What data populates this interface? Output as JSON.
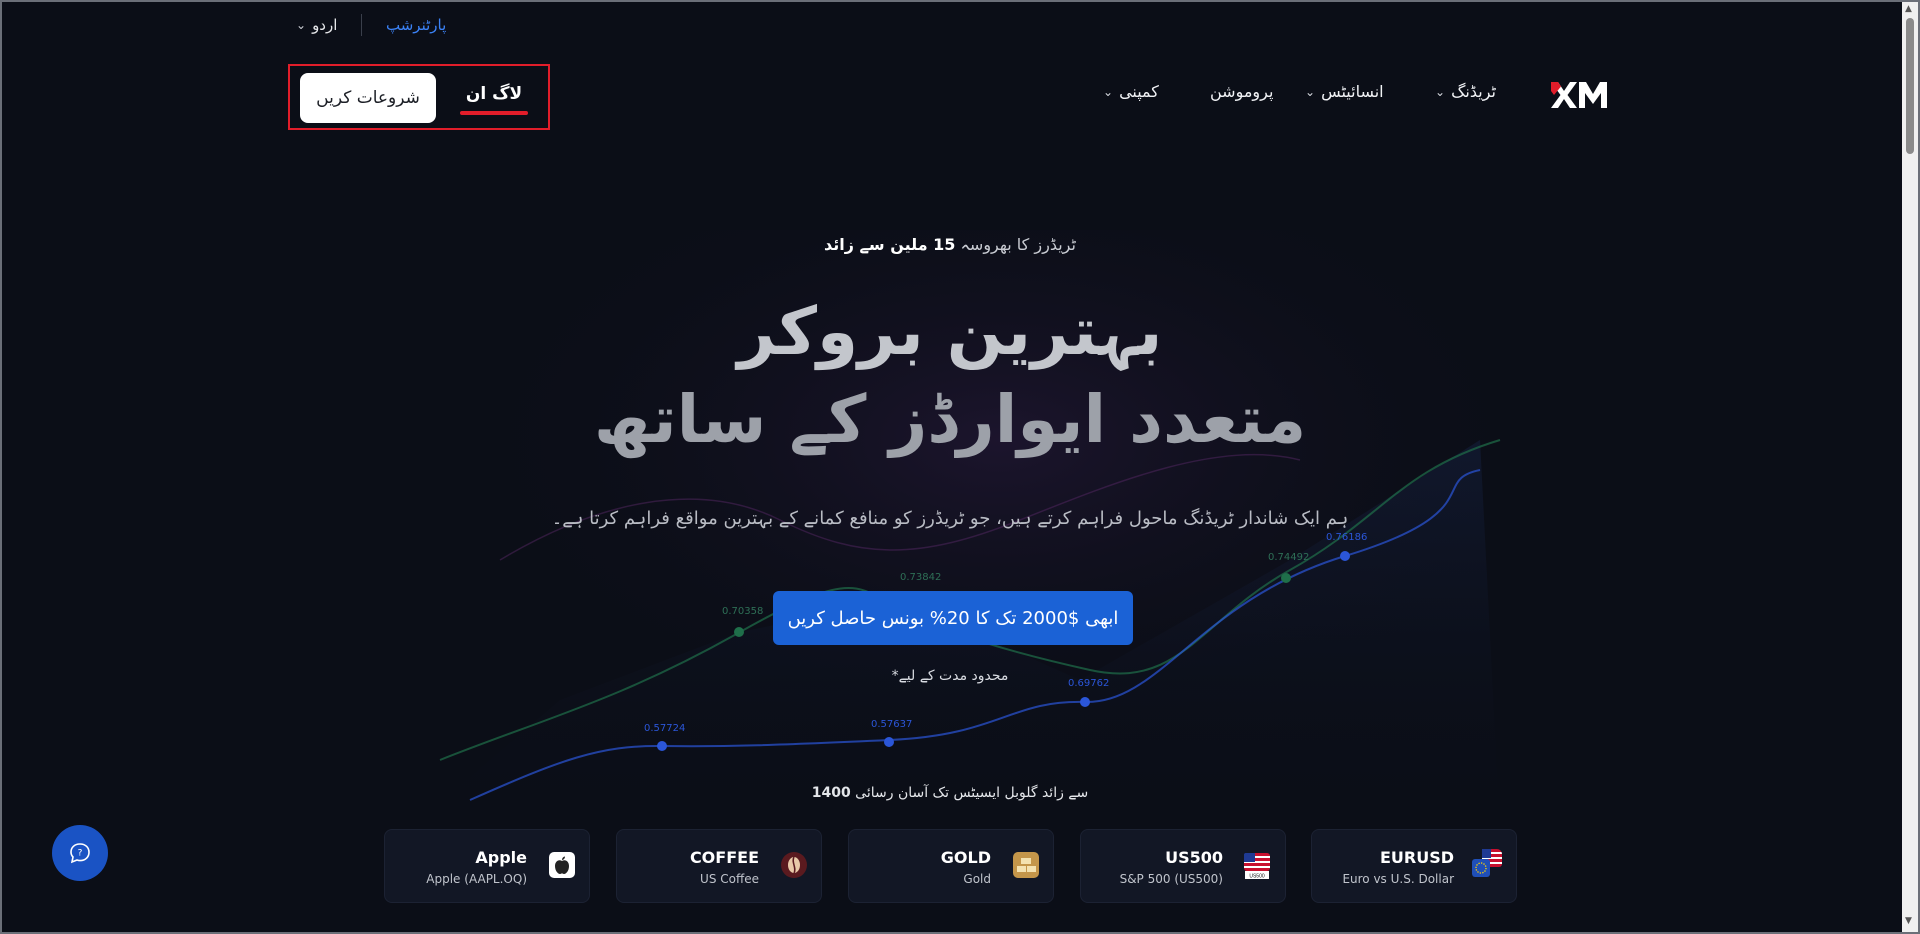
{
  "topbar": {
    "language": "اردو",
    "partnership": "پارٹنرشپ"
  },
  "nav": {
    "items": [
      {
        "label": "ٹریڈنگ",
        "has_dropdown": true
      },
      {
        "label": "انسائیٹس",
        "has_dropdown": true
      },
      {
        "label": "پروموشن",
        "has_dropdown": false
      },
      {
        "label": "کمپنی",
        "has_dropdown": true
      }
    ],
    "login_label": "لاگ ان",
    "start_label": "شروعات کریں",
    "accent_color": "#e11d2a"
  },
  "hero": {
    "trust_bold": "15 ملین سے زائد",
    "trust_rest": "ٹریڈرز کا بھروسہ",
    "headline_line1": "بہترین بروکر",
    "headline_line2": "متعدد ایوارڈز کے ساتھ",
    "subtitle": "ہم ایک شاندار ٹریڈنگ ماحول فراہم کرتے ہیں، جو ٹریڈرز کو منافع کمانے کے بہترین مواقع فراہم کرتا ہے۔",
    "cta_label": "ابھی $2000 تک کا 20% بونس حاصل کریں",
    "cta_color": "#1b62d6",
    "limited_note": "*محدود مدت کے لیے"
  },
  "chart_labels": [
    "0.70358",
    "0.73842",
    "0.74492",
    "0.76186",
    "0.69762",
    "0.57724",
    "0.57637"
  ],
  "access_text_bold": "1400",
  "access_text": "سے زائد گلوبل ایسیٹس تک آسان رسائی",
  "instruments": [
    {
      "symbol": "EURUSD",
      "desc": "Euro vs U.S. Dollar",
      "icon": "eu-us-flag-icon"
    },
    {
      "symbol": "US500",
      "desc": "S&P 500 (US500)",
      "icon": "us-flag-icon",
      "icon_badge": "US500"
    },
    {
      "symbol": "GOLD",
      "desc": "Gold",
      "icon": "gold-bars-icon"
    },
    {
      "symbol": "COFFEE",
      "desc": "US Coffee",
      "icon": "coffee-bean-icon"
    },
    {
      "symbol": "Apple",
      "desc": "Apple (AAPL.OQ)",
      "icon": "apple-icon"
    }
  ]
}
